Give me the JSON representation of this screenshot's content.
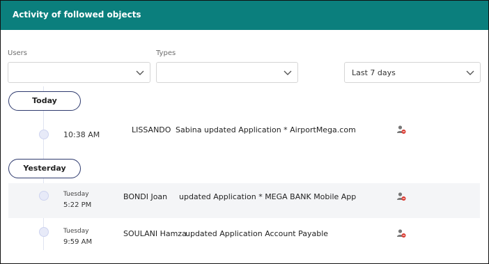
{
  "header": {
    "title": "Activity of followed objects"
  },
  "filters": {
    "users": {
      "label": "Users",
      "value": ""
    },
    "types": {
      "label": "Types",
      "value": ""
    },
    "period": {
      "value": "Last 7 days"
    }
  },
  "groups": [
    {
      "label": "Today",
      "items": [
        {
          "day": "",
          "time": "10:38 AM",
          "user": "LISSANDO",
          "description": "Sabina updated Application * AirportMega.com"
        }
      ]
    },
    {
      "label": "Yesterday",
      "items": [
        {
          "day": "Tuesday",
          "time": "5:22 PM",
          "user": "BONDI Joan",
          "description": "updated Application * MEGA BANK Mobile App"
        },
        {
          "day": "Tuesday",
          "time": "9:59 AM",
          "user": "SOULANI Hamza",
          "description": "updated Application Account Payable"
        }
      ]
    }
  ],
  "icons": {
    "unfollow": "user-remove-icon",
    "dropdown": "chevron-down-icon"
  },
  "colors": {
    "header": "#0b7f7d",
    "pill_border": "#2e3a6e",
    "unfollow_badge": "#d9342b"
  }
}
